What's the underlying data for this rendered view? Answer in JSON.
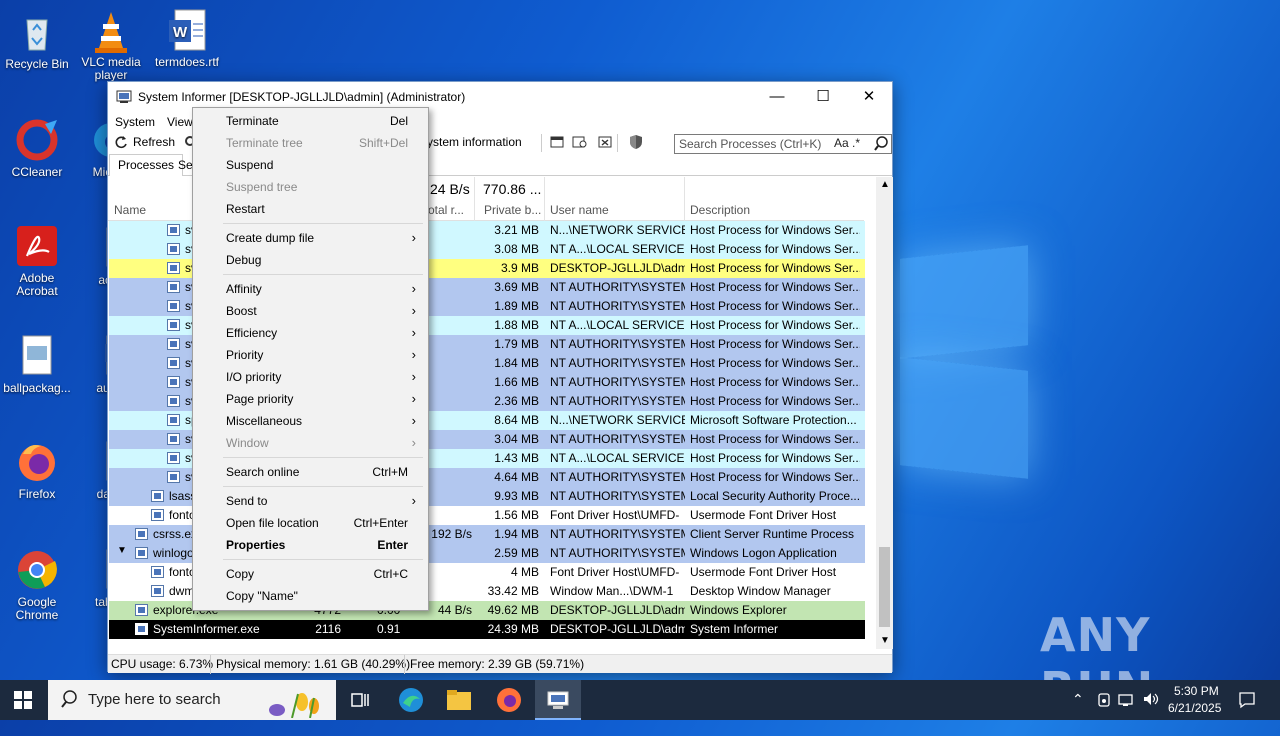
{
  "desktop": {
    "icons": [
      {
        "label": "Recycle Bin"
      },
      {
        "label": "VLC media player"
      },
      {
        "label": "termdoes.rtf"
      },
      {
        "label": "CCleaner"
      },
      {
        "label": "Mic Ed"
      },
      {
        "label": "Adobe Acrobat"
      },
      {
        "label": "acco"
      },
      {
        "label": "ballpackag..."
      },
      {
        "label": "authc"
      },
      {
        "label": "Firefox"
      },
      {
        "label": "david"
      },
      {
        "label": "Google Chrome"
      },
      {
        "label": "tablec"
      }
    ]
  },
  "watermark": "ANY RUN",
  "window": {
    "title": "System Informer [DESKTOP-JGLLJLD\\admin] (Administrator)",
    "menu": [
      "System",
      "View"
    ],
    "toolbar": {
      "refresh": "Refresh",
      "sysinfo": "ystem information"
    },
    "search_placeholder": "Search Processes (Ctrl+K)",
    "search_opts": "Aa .*",
    "tabs": [
      "Processes",
      "Se"
    ],
    "header": {
      "name": "Name",
      "io_top": "24 B/s",
      "io_label": "otal r...",
      "priv_top": "770.86 ...",
      "priv_label": "Private b...",
      "user": "User name",
      "desc": "Description"
    },
    "rows": [
      {
        "name": "sv",
        "pid": "",
        "cpu": "",
        "io": "",
        "priv": "3.21 MB",
        "user": "N...\\NETWORK SERVICE",
        "desc": "Host Process for Windows Ser...",
        "bg": "cyan",
        "indent": 3
      },
      {
        "name": "sv",
        "pid": "",
        "cpu": "",
        "io": "",
        "priv": "3.08 MB",
        "user": "NT A...\\LOCAL SERVICE",
        "desc": "Host Process for Windows Ser...",
        "bg": "cyan",
        "indent": 3
      },
      {
        "name": "sv",
        "pid": "",
        "cpu": "",
        "io": "",
        "priv": "3.9 MB",
        "user": "DESKTOP-JGLLJLD\\admi",
        "desc": "Host Process for Windows Ser...",
        "bg": "yellow",
        "indent": 3
      },
      {
        "name": "sv",
        "pid": "",
        "cpu": "",
        "io": "",
        "priv": "3.69 MB",
        "user": "NT AUTHORITY\\SYSTEM",
        "desc": "Host Process for Windows Ser...",
        "bg": "blue",
        "indent": 3
      },
      {
        "name": "sv",
        "pid": "",
        "cpu": "",
        "io": "",
        "priv": "1.89 MB",
        "user": "NT AUTHORITY\\SYSTEM",
        "desc": "Host Process for Windows Ser...",
        "bg": "blue",
        "indent": 3
      },
      {
        "name": "sv",
        "pid": "",
        "cpu": "",
        "io": "",
        "priv": "1.88 MB",
        "user": "NT A...\\LOCAL SERVICE",
        "desc": "Host Process for Windows Ser...",
        "bg": "cyan",
        "indent": 3
      },
      {
        "name": "sv",
        "pid": "",
        "cpu": "",
        "io": "",
        "priv": "1.79 MB",
        "user": "NT AUTHORITY\\SYSTEM",
        "desc": "Host Process for Windows Ser...",
        "bg": "blue",
        "indent": 3
      },
      {
        "name": "sv",
        "pid": "",
        "cpu": "",
        "io": "",
        "priv": "1.84 MB",
        "user": "NT AUTHORITY\\SYSTEM",
        "desc": "Host Process for Windows Ser...",
        "bg": "blue",
        "indent": 3
      },
      {
        "name": "sv",
        "pid": "",
        "cpu": "",
        "io": "",
        "priv": "1.66 MB",
        "user": "NT AUTHORITY\\SYSTEM",
        "desc": "Host Process for Windows Ser...",
        "bg": "blue",
        "indent": 3
      },
      {
        "name": "sv",
        "pid": "",
        "cpu": "",
        "io": "",
        "priv": "2.36 MB",
        "user": "NT AUTHORITY\\SYSTEM",
        "desc": "Host Process for Windows Ser...",
        "bg": "blue",
        "indent": 3
      },
      {
        "name": "sp",
        "pid": "",
        "cpu": "",
        "io": "",
        "priv": "8.64 MB",
        "user": "N...\\NETWORK SERVICE",
        "desc": "Microsoft Software Protection...",
        "bg": "cyan",
        "indent": 3
      },
      {
        "name": "sv",
        "pid": "",
        "cpu": "",
        "io": "",
        "priv": "3.04 MB",
        "user": "NT AUTHORITY\\SYSTEM",
        "desc": "Host Process for Windows Ser...",
        "bg": "blue",
        "indent": 3
      },
      {
        "name": "sv",
        "pid": "",
        "cpu": "",
        "io": "",
        "priv": "1.43 MB",
        "user": "NT A...\\LOCAL SERVICE",
        "desc": "Host Process for Windows Ser...",
        "bg": "cyan",
        "indent": 3
      },
      {
        "name": "sv",
        "pid": "",
        "cpu": "",
        "io": "",
        "priv": "4.64 MB",
        "user": "NT AUTHORITY\\SYSTEM",
        "desc": "Host Process for Windows Ser...",
        "bg": "blue",
        "indent": 3
      },
      {
        "name": "lsass",
        "pid": "",
        "cpu": "",
        "io": "",
        "priv": "9.93 MB",
        "user": "NT AUTHORITY\\SYSTEM",
        "desc": "Local Security Authority Proce...",
        "bg": "blue",
        "indent": 2
      },
      {
        "name": "fonto",
        "pid": "",
        "cpu": "",
        "io": "",
        "priv": "1.56 MB",
        "user": "Font Driver Host\\UMFD-",
        "desc": "Usermode Font Driver Host",
        "bg": "white",
        "indent": 2
      },
      {
        "name": "csrss.ex",
        "pid": "",
        "cpu": "",
        "io": "192 B/s",
        "priv": "1.94 MB",
        "user": "NT AUTHORITY\\SYSTEM",
        "desc": "Client Server Runtime Process",
        "bg": "blue",
        "indent": 1
      },
      {
        "name": "winlogo",
        "pid": "",
        "cpu": "",
        "io": "",
        "priv": "2.59 MB",
        "user": "NT AUTHORITY\\SYSTEM",
        "desc": "Windows Logon Application",
        "bg": "blue",
        "indent": 1
      },
      {
        "name": "fonto",
        "pid": "",
        "cpu": "",
        "io": "",
        "priv": "4 MB",
        "user": "Font Driver Host\\UMFD-",
        "desc": "Usermode Font Driver Host",
        "bg": "white",
        "indent": 2
      },
      {
        "name": "dwm",
        "pid": "",
        "cpu": "",
        "io": "",
        "priv": "33.42 MB",
        "user": "Window Man...\\DWM-1",
        "desc": "Desktop Window Manager",
        "bg": "white",
        "indent": 2
      },
      {
        "name": "explorer.exe",
        "pid": "4772",
        "cpu": "0.00",
        "io": "44 B/s",
        "priv": "49.62 MB",
        "user": "DESKTOP-JGLLJLD\\admi",
        "desc": "Windows Explorer",
        "bg": "green",
        "indent": 1
      },
      {
        "name": "SystemInformer.exe",
        "pid": "2116",
        "cpu": "0.91",
        "io": "",
        "priv": "24.39 MB",
        "user": "DESKTOP-JGLLJLD\\admi",
        "desc": "System Informer",
        "bg": "sel",
        "indent": 1
      }
    ],
    "status": {
      "cpu": "CPU usage: 6.73%",
      "phys": "Physical memory: 1.61 GB (40.29%)",
      "free": "Free memory: 2.39 GB (59.71%)"
    }
  },
  "context_menu": {
    "items": [
      {
        "label": "Terminate",
        "shortcut": "Del",
        "disabled": false,
        "submenu": false,
        "bold": false
      },
      {
        "label": "Terminate tree",
        "shortcut": "Shift+Del",
        "disabled": true,
        "submenu": false,
        "bold": false
      },
      {
        "label": "Suspend",
        "shortcut": "",
        "disabled": false,
        "submenu": false,
        "bold": false
      },
      {
        "label": "Suspend tree",
        "shortcut": "",
        "disabled": true,
        "submenu": false,
        "bold": false
      },
      {
        "label": "Restart",
        "shortcut": "",
        "disabled": false,
        "submenu": false,
        "bold": false
      },
      {
        "sep": true
      },
      {
        "label": "Create dump file",
        "shortcut": "",
        "disabled": false,
        "submenu": true,
        "bold": false
      },
      {
        "label": "Debug",
        "shortcut": "",
        "disabled": false,
        "submenu": false,
        "bold": false
      },
      {
        "sep": true
      },
      {
        "label": "Affinity",
        "shortcut": "",
        "disabled": false,
        "submenu": true,
        "bold": false
      },
      {
        "label": "Boost",
        "shortcut": "",
        "disabled": false,
        "submenu": true,
        "bold": false
      },
      {
        "label": "Efficiency",
        "shortcut": "",
        "disabled": false,
        "submenu": true,
        "bold": false
      },
      {
        "label": "Priority",
        "shortcut": "",
        "disabled": false,
        "submenu": true,
        "bold": false
      },
      {
        "label": "I/O priority",
        "shortcut": "",
        "disabled": false,
        "submenu": true,
        "bold": false
      },
      {
        "label": "Page priority",
        "shortcut": "",
        "disabled": false,
        "submenu": true,
        "bold": false
      },
      {
        "label": "Miscellaneous",
        "shortcut": "",
        "disabled": false,
        "submenu": true,
        "bold": false
      },
      {
        "label": "Window",
        "shortcut": "",
        "disabled": true,
        "submenu": true,
        "bold": false
      },
      {
        "sep": true
      },
      {
        "label": "Search online",
        "shortcut": "Ctrl+M",
        "disabled": false,
        "submenu": false,
        "bold": false
      },
      {
        "sep": true
      },
      {
        "label": "Send to",
        "shortcut": "",
        "disabled": false,
        "submenu": true,
        "bold": false
      },
      {
        "label": "Open file location",
        "shortcut": "Ctrl+Enter",
        "disabled": false,
        "submenu": false,
        "bold": false
      },
      {
        "label": "Properties",
        "shortcut": "Enter",
        "disabled": false,
        "submenu": false,
        "bold": true
      },
      {
        "sep": true
      },
      {
        "label": "Copy",
        "shortcut": "Ctrl+C",
        "disabled": false,
        "submenu": false,
        "bold": false
      },
      {
        "label": "Copy \"Name\"",
        "shortcut": "",
        "disabled": false,
        "submenu": false,
        "bold": false
      }
    ]
  },
  "taskbar": {
    "search_placeholder": "Type here to search",
    "time": "5:30 PM",
    "date": "6/21/2025"
  },
  "colors": {
    "row_cyan": "#d0f8ff",
    "row_blue": "#b2c7ef",
    "row_yellow": "#ffff80",
    "row_green": "#c2e5b2",
    "row_selected": "#000000"
  }
}
